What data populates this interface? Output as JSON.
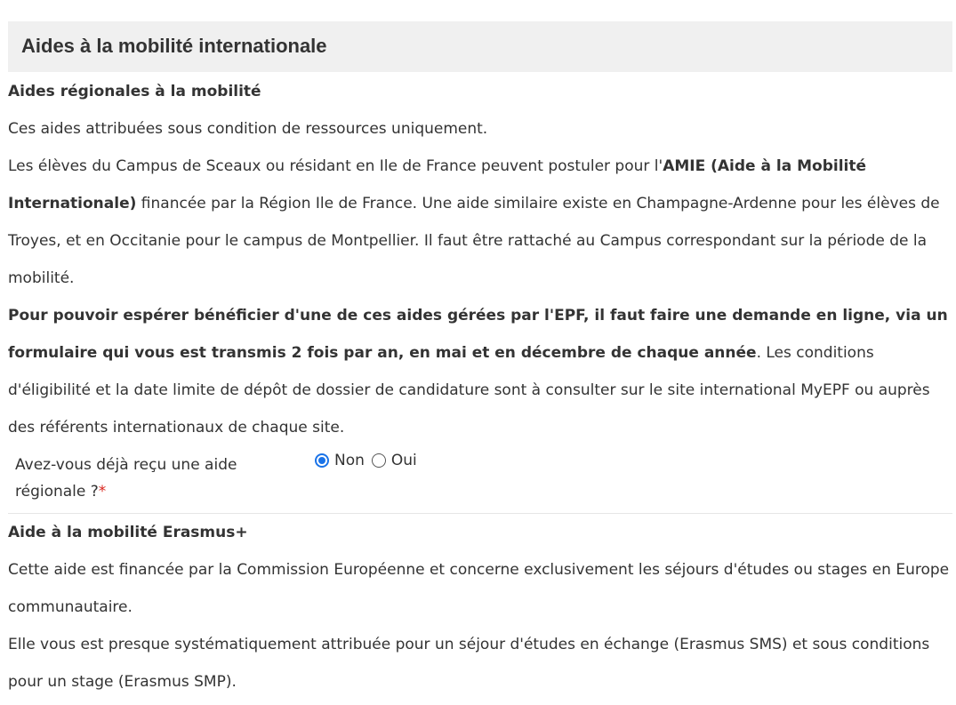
{
  "header": {
    "title": "Aides à la mobilité internationale"
  },
  "regional": {
    "subtitle": "Aides régionales à la mobilité",
    "p1": "Ces aides attribuées sous condition de ressources uniquement.",
    "p2_part1": "Les élèves du Campus de Sceaux ou résidant en Ile de France peuvent postuler pour l'",
    "p2_bold": "AMIE (Aide à la Mobilité Internationale)",
    "p2_part2": " financée par la Région Ile de France. Une aide similaire existe en Champagne-Ardenne pour les élèves de Troyes, et en Occitanie pour le campus de Montpellier. Il faut être rattaché au Campus correspondant sur la période de la mobilité.",
    "p3_bold": "Pour pouvoir espérer bénéficier d'une de ces aides gérées par l'EPF, il faut faire une demande en ligne, via un formulaire qui vous est transmis 2 fois par an, en mai et en décembre de chaque année",
    "p3_rest": ". Les conditions d'éligibilité et la date limite de dépôt de dossier de candidature sont à consulter sur le site international MyEPF ou auprès des référents internationaux de chaque site."
  },
  "question": {
    "label": "Avez-vous déjà reçu une aide régionale ?",
    "required_mark": "*",
    "options": [
      {
        "label": "Non",
        "checked": true
      },
      {
        "label": "Oui",
        "checked": false
      }
    ]
  },
  "erasmus": {
    "subtitle": "Aide à la mobilité Erasmus+",
    "p1": "Cette aide est financée par la Commission Européenne et concerne exclusivement les séjours d'études ou stages en Europe communautaire.",
    "p2": "Elle vous est presque systématiquement attribuée pour un séjour d'études en échange (Erasmus SMS) et sous conditions pour un stage (Erasmus SMP)."
  },
  "colors": {
    "header_bg": "#f0f0f0",
    "text": "#333333",
    "required": "#d9241c",
    "radio_accent": "#1a73e8"
  }
}
